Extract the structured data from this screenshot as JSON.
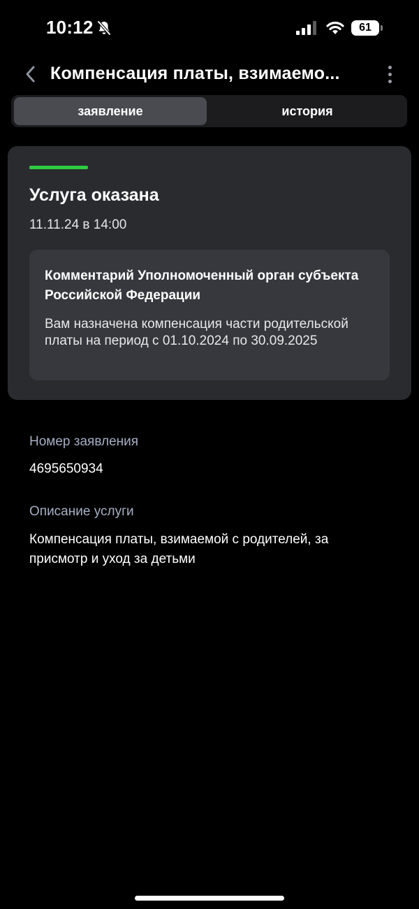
{
  "status_bar": {
    "time": "10:12",
    "battery_level": "61",
    "icons": [
      "bell-slash-icon",
      "signal-icon",
      "wifi-icon",
      "battery-icon"
    ]
  },
  "header": {
    "title": "Компенсация платы, взимаемо...",
    "back_icon": "chevron-left-icon",
    "more_icon": "more-vertical-icon"
  },
  "tabs": [
    {
      "label": "заявление",
      "active": true
    },
    {
      "label": "история",
      "active": false
    }
  ],
  "status_card": {
    "accent_color": "#2ecc40",
    "title": "Услуга оказана",
    "date": "11.11.24 в 14:00",
    "comment": {
      "title": "Комментарий Уполномоченный орган субъекта Российской Федерации",
      "text": "Вам назначена компенсация части родительской платы на период с 01.10.2024 по 30.09.2025"
    }
  },
  "details": {
    "application_number_label": "Номер заявления",
    "application_number": "4695650934",
    "service_description_label": "Описание услуги",
    "service_description": "Компенсация платы, взимаемой с родителей, за присмотр и уход за детьми"
  }
}
